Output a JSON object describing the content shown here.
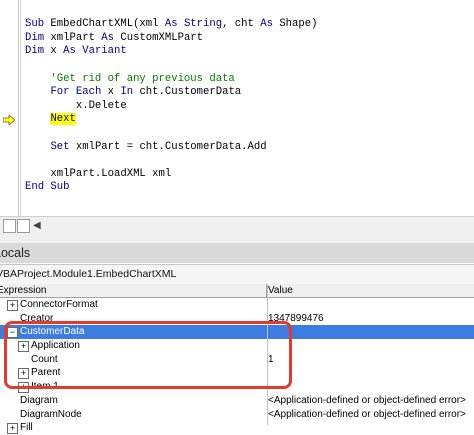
{
  "code": {
    "lines": [
      {
        "parts": [
          {
            "t": "End Sub",
            "c": "kw"
          }
        ]
      },
      {
        "parts": []
      },
      {
        "parts": [
          {
            "t": "Sub",
            "c": "kw"
          },
          {
            "t": " EmbedChartXML(xml ",
            "c": ""
          },
          {
            "t": "As String",
            "c": "kw"
          },
          {
            "t": ", cht ",
            "c": ""
          },
          {
            "t": "As",
            "c": "kw"
          },
          {
            "t": " Shape)",
            "c": ""
          }
        ]
      },
      {
        "parts": [
          {
            "t": "Dim",
            "c": "kw"
          },
          {
            "t": " xmlPart ",
            "c": ""
          },
          {
            "t": "As",
            "c": "kw"
          },
          {
            "t": " CustomXMLPart",
            "c": ""
          }
        ]
      },
      {
        "parts": [
          {
            "t": "Dim",
            "c": "kw"
          },
          {
            "t": " x ",
            "c": ""
          },
          {
            "t": "As Variant",
            "c": "kw"
          }
        ]
      },
      {
        "parts": []
      },
      {
        "parts": [
          {
            "t": "    'Get rid of any previous data",
            "c": "cm"
          }
        ]
      },
      {
        "parts": [
          {
            "t": "    ",
            "c": ""
          },
          {
            "t": "For Each",
            "c": "kw"
          },
          {
            "t": " x ",
            "c": ""
          },
          {
            "t": "In",
            "c": "kw"
          },
          {
            "t": " cht.CustomerData",
            "c": ""
          }
        ]
      },
      {
        "parts": [
          {
            "t": "        x.Delete",
            "c": ""
          }
        ]
      },
      {
        "parts": [
          {
            "t": "    ",
            "c": ""
          },
          {
            "t": "Next",
            "c": "kw hl"
          }
        ]
      },
      {
        "parts": []
      },
      {
        "parts": [
          {
            "t": "    ",
            "c": ""
          },
          {
            "t": "Set",
            "c": "kw"
          },
          {
            "t": " xmlPart = cht.CustomerData.Add",
            "c": ""
          }
        ]
      },
      {
        "parts": []
      },
      {
        "parts": [
          {
            "t": "    xmlPart.LoadXML xml",
            "c": ""
          }
        ]
      },
      {
        "parts": [
          {
            "t": "End Sub",
            "c": "kw"
          }
        ]
      }
    ]
  },
  "locals": {
    "title": "Locals",
    "context": "VBAProject.Module1.EmbedChartXML",
    "columns": {
      "expression": "Expression",
      "value": "Value"
    },
    "rows": [
      {
        "expr": "ConnectorFormat",
        "value": "",
        "indent": 0,
        "box": "+",
        "selected": false
      },
      {
        "expr": "Creator",
        "value": "1347899476",
        "indent": 0,
        "box": "",
        "selected": false
      },
      {
        "expr": "CustomerData",
        "value": "",
        "indent": 0,
        "box": "−",
        "selected": true
      },
      {
        "expr": "Application",
        "value": "",
        "indent": 1,
        "box": "+",
        "selected": false
      },
      {
        "expr": "Count",
        "value": "1",
        "indent": 1,
        "box": "",
        "selected": false
      },
      {
        "expr": "Parent",
        "value": "",
        "indent": 1,
        "box": "+",
        "selected": false
      },
      {
        "expr": "Item 1",
        "value": "",
        "indent": 1,
        "box": "+",
        "selected": false
      },
      {
        "expr": "Diagram",
        "value": "<Application-defined or object-defined error>",
        "indent": 0,
        "box": "",
        "selected": false
      },
      {
        "expr": "DiagramNode",
        "value": "<Application-defined or object-defined error>",
        "indent": 0,
        "box": "",
        "selected": false
      },
      {
        "expr": "Fill",
        "value": "",
        "indent": 0,
        "box": "+",
        "selected": false
      }
    ]
  },
  "colors": {
    "keyword": "#00008b",
    "comment": "#008000",
    "highlight": "#ffff00",
    "selection": "#3c7ddf",
    "annotation": "#e53b2c"
  }
}
